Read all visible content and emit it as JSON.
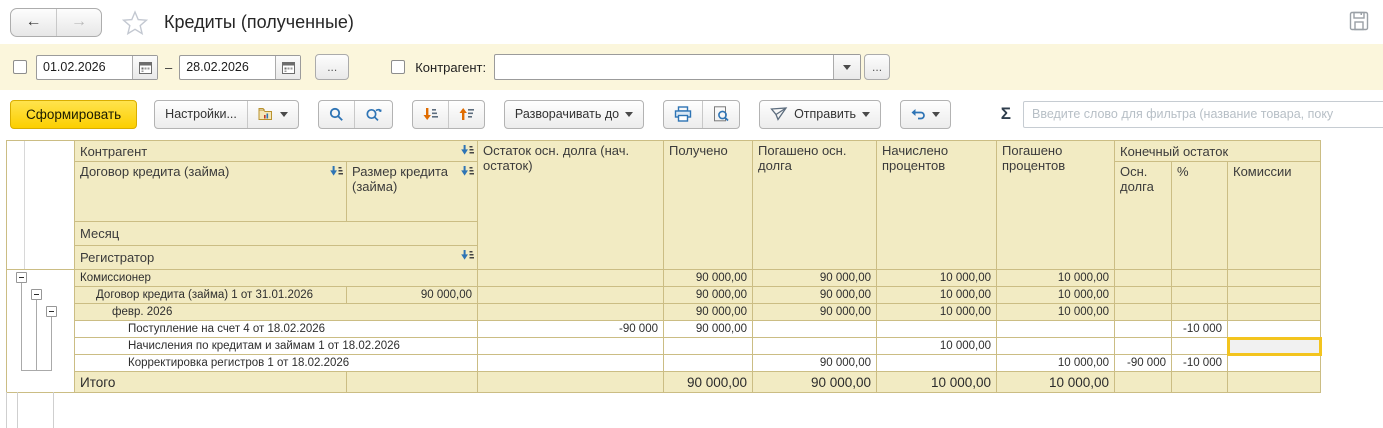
{
  "topbar": {
    "title": "Кредиты (полученные)"
  },
  "filterbar": {
    "date_from": "01.02.2026",
    "dash": "–",
    "date_to": "28.02.2026",
    "ellipsis": "...",
    "counterparty_label": "Контрагент:",
    "counterparty_value": ""
  },
  "toolbar": {
    "generate": "Сформировать",
    "settings": "Настройки...",
    "expand_to": "Разворачивать до",
    "send": "Отправить",
    "sum_symbol": "Σ",
    "filter_placeholder": "Введите слово для фильтра (название товара, поку"
  },
  "icons": {
    "back-icon": "←",
    "forward-icon": "→",
    "star-icon": "favorite-star-outline",
    "save-icon": "floppy-disk",
    "calendar-icon": "calendar",
    "dropdown-icon": "caret-down",
    "report-variants-icon": "folder-chart",
    "search-icon": "magnifier",
    "search-next-icon": "magnifier-repeat",
    "sort-desc-icon": "arrow-down-list",
    "sort-asc-icon": "arrow-up-list",
    "print-icon": "printer",
    "preview-icon": "page-magnifier",
    "send-icon": "paper-plane",
    "history-icon": "curved-arrow",
    "sort-column-icon": "blue-arrow-bars",
    "collapse-icon": "minus-box"
  },
  "colors": {
    "bar_yellow": "#fbf6dc",
    "cell_yellow": "#f2ebc3",
    "grid_line": "#cbbd84",
    "generate_button": "#fccf00",
    "negative": "#e60000",
    "selection": "#f3c41e",
    "icon_blue": "#2e74b5",
    "icon_orange": "#e06c00"
  },
  "report": {
    "header": {
      "counterparty": "Контрагент",
      "contract": "Договор кредита (займа)",
      "loan_size": "Размер кредита (займа)",
      "month": "Месяц",
      "registrar": "Регистратор",
      "opening": "Остаток осн. долга (нач. остаток)",
      "received": "Получено",
      "repaid_principal": "Погашено осн. долга",
      "accrued_interest": "Начислено процентов",
      "repaid_interest": "Погашено процентов",
      "closing": "Конечный остаток",
      "closing_principal": "Осн. долга",
      "closing_percent": "%",
      "closing_commission": "Комиссии"
    },
    "rows": [
      {
        "label": "Комиссионер",
        "loan_size": "",
        "opening": "",
        "received": "90 000,00",
        "repaid_principal": "90 000,00",
        "accrued": "10 000,00",
        "repaid_interest": "10 000,00",
        "closing_principal": "",
        "closing_percent": "",
        "closing_commission": ""
      },
      {
        "label": "Договор кредита (займа) 1 от 31.01.2026",
        "loan_size": "90 000,00",
        "opening": "",
        "received": "90 000,00",
        "repaid_principal": "90 000,00",
        "accrued": "10 000,00",
        "repaid_interest": "10 000,00",
        "closing_principal": "",
        "closing_percent": "",
        "closing_commission": ""
      },
      {
        "label": "февр. 2026",
        "loan_size": "",
        "opening": "",
        "received": "90 000,00",
        "repaid_principal": "90 000,00",
        "accrued": "10 000,00",
        "repaid_interest": "10 000,00",
        "closing_principal": "",
        "closing_percent": "",
        "closing_commission": ""
      },
      {
        "label": "Поступление на счет 4 от 18.02.2026",
        "loan_size": "",
        "opening": "-90 000",
        "received": "90 000,00",
        "repaid_principal": "",
        "accrued": "",
        "repaid_interest": "",
        "closing_principal": "",
        "closing_percent": "-10 000",
        "closing_commission": ""
      },
      {
        "label": "Начисления по кредитам и займам 1 от 18.02.2026",
        "loan_size": "",
        "opening": "",
        "received": "",
        "repaid_principal": "",
        "accrued": "10 000,00",
        "repaid_interest": "",
        "closing_principal": "",
        "closing_percent": "",
        "closing_commission": ""
      },
      {
        "label": "Корректировка регистров 1 от 18.02.2026",
        "loan_size": "",
        "opening": "",
        "received": "",
        "repaid_principal": "90 000,00",
        "accrued": "",
        "repaid_interest": "10 000,00",
        "closing_principal": "-90 000",
        "closing_percent": "-10 000",
        "closing_commission": ""
      }
    ],
    "total": {
      "label": "Итого",
      "loan_size": "",
      "opening": "",
      "received": "90 000,00",
      "repaid_principal": "90 000,00",
      "accrued": "10 000,00",
      "repaid_interest": "10 000,00",
      "closing_principal": "",
      "closing_percent": "",
      "closing_commission": ""
    }
  }
}
